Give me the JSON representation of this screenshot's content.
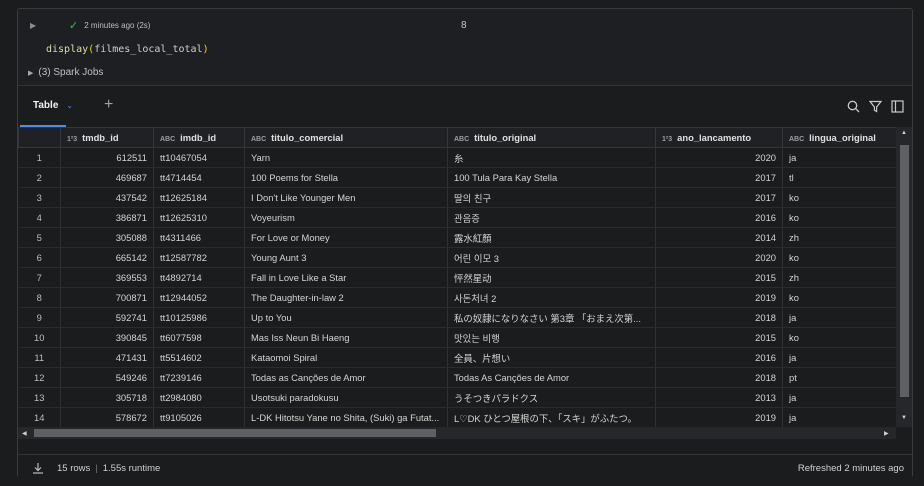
{
  "cell": {
    "status": "2 minutes ago (2s)",
    "number": "8",
    "code_fn": "display",
    "code_open": "(",
    "code_arg": "filmes_local_total",
    "code_close": ")",
    "spark_jobs": "(3) Spark Jobs"
  },
  "result": {
    "tab_label": "Table",
    "columns": [
      {
        "name": "",
        "type": ""
      },
      {
        "name": "tmdb_id",
        "type": "1²3"
      },
      {
        "name": "imdb_id",
        "type": "ABC"
      },
      {
        "name": "titulo_comercial",
        "type": "ABC"
      },
      {
        "name": "titulo_original",
        "type": "ABC"
      },
      {
        "name": "ano_lancamento",
        "type": "1²3"
      },
      {
        "name": "lingua_original",
        "type": "ABC"
      }
    ],
    "rows": [
      [
        "1",
        "612511",
        "tt10467054",
        "Yarn",
        "糸",
        "2020",
        "ja"
      ],
      [
        "2",
        "469687",
        "tt4714454",
        "100 Poems for Stella",
        "100 Tula Para Kay Stella",
        "2017",
        "tl"
      ],
      [
        "3",
        "437542",
        "tt12625184",
        "I Don't Like Younger Men",
        "딸의 친구",
        "2017",
        "ko"
      ],
      [
        "4",
        "386871",
        "tt12625310",
        "Voyeurism",
        "관음증",
        "2016",
        "ko"
      ],
      [
        "5",
        "305088",
        "tt4311466",
        "For Love or Money",
        "露水紅顏",
        "2014",
        "zh"
      ],
      [
        "6",
        "665142",
        "tt12587782",
        "Young Aunt 3",
        "어린 이모 3",
        "2020",
        "ko"
      ],
      [
        "7",
        "369553",
        "tt4892714",
        "Fall in Love Like a Star",
        "怦然星动",
        "2015",
        "zh"
      ],
      [
        "8",
        "700871",
        "tt12944052",
        "The Daughter-in-law 2",
        "사돈처녀 2",
        "2019",
        "ko"
      ],
      [
        "9",
        "592741",
        "tt10125986",
        "Up to You",
        "私の奴隷になりなさい 第3章 「おまえ次第...",
        "2018",
        "ja"
      ],
      [
        "10",
        "390845",
        "tt6077598",
        "Mas Iss Neun Bi Haeng",
        "맛있는 비행",
        "2015",
        "ko"
      ],
      [
        "11",
        "471431",
        "tt5514602",
        "Kataomoi Spiral",
        "全員、片想い",
        "2016",
        "ja"
      ],
      [
        "12",
        "549246",
        "tt7239146",
        "Todas as Canções de Amor",
        "Todas As Canções de Amor",
        "2018",
        "pt"
      ],
      [
        "13",
        "305718",
        "tt2984080",
        "Usotsuki paradokusu",
        "うそつきパラドクス",
        "2013",
        "ja"
      ],
      [
        "14",
        "578672",
        "tt9105026",
        "L-DK Hitotsu Yane no Shita, (Suki) ga Futat...",
        "L♡DK ひとつ屋根の下、「スキ」がふたつ。",
        "2019",
        "ja"
      ]
    ],
    "footer_rows": "15 rows",
    "footer_runtime": "1.55s runtime",
    "refreshed": "Refreshed 2 minutes ago"
  }
}
